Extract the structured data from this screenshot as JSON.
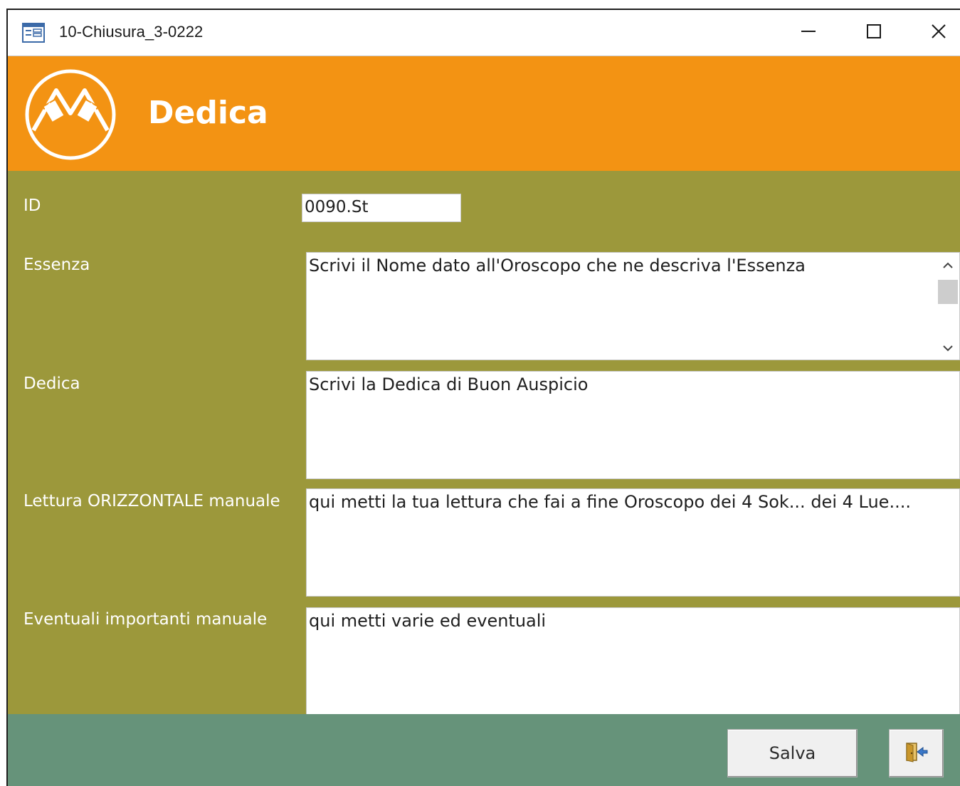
{
  "window": {
    "title": "10-Chiusura_3-0222",
    "app_icon": "form-icon",
    "controls": [
      "minimize-icon",
      "maximize-icon",
      "close-icon"
    ]
  },
  "header": {
    "title": "Dedica",
    "logo": "circle-logo",
    "background": "#f39313"
  },
  "form": {
    "background": "#9c983b",
    "fields": {
      "id": {
        "label": "ID",
        "value": "0090.St"
      },
      "essenza": {
        "label": "Essenza",
        "value": "Scrivi il Nome dato all'Oroscopo che ne descriva l'Essenza"
      },
      "dedica": {
        "label": "Dedica",
        "value": "Scrivi la Dedica di Buon Auspicio"
      },
      "lettura": {
        "label": "Lettura ORIZZONTALE manuale",
        "value": "qui metti la tua lettura che fai a fine Oroscopo dei 4 Sok... dei 4 Lue...."
      },
      "eventuali": {
        "label": "Eventuali importanti manuale",
        "value": "qui metti varie ed eventuali"
      }
    }
  },
  "footer": {
    "background": "#66937a",
    "save_label": "Salva",
    "exit_icon": "exit-door-icon"
  }
}
